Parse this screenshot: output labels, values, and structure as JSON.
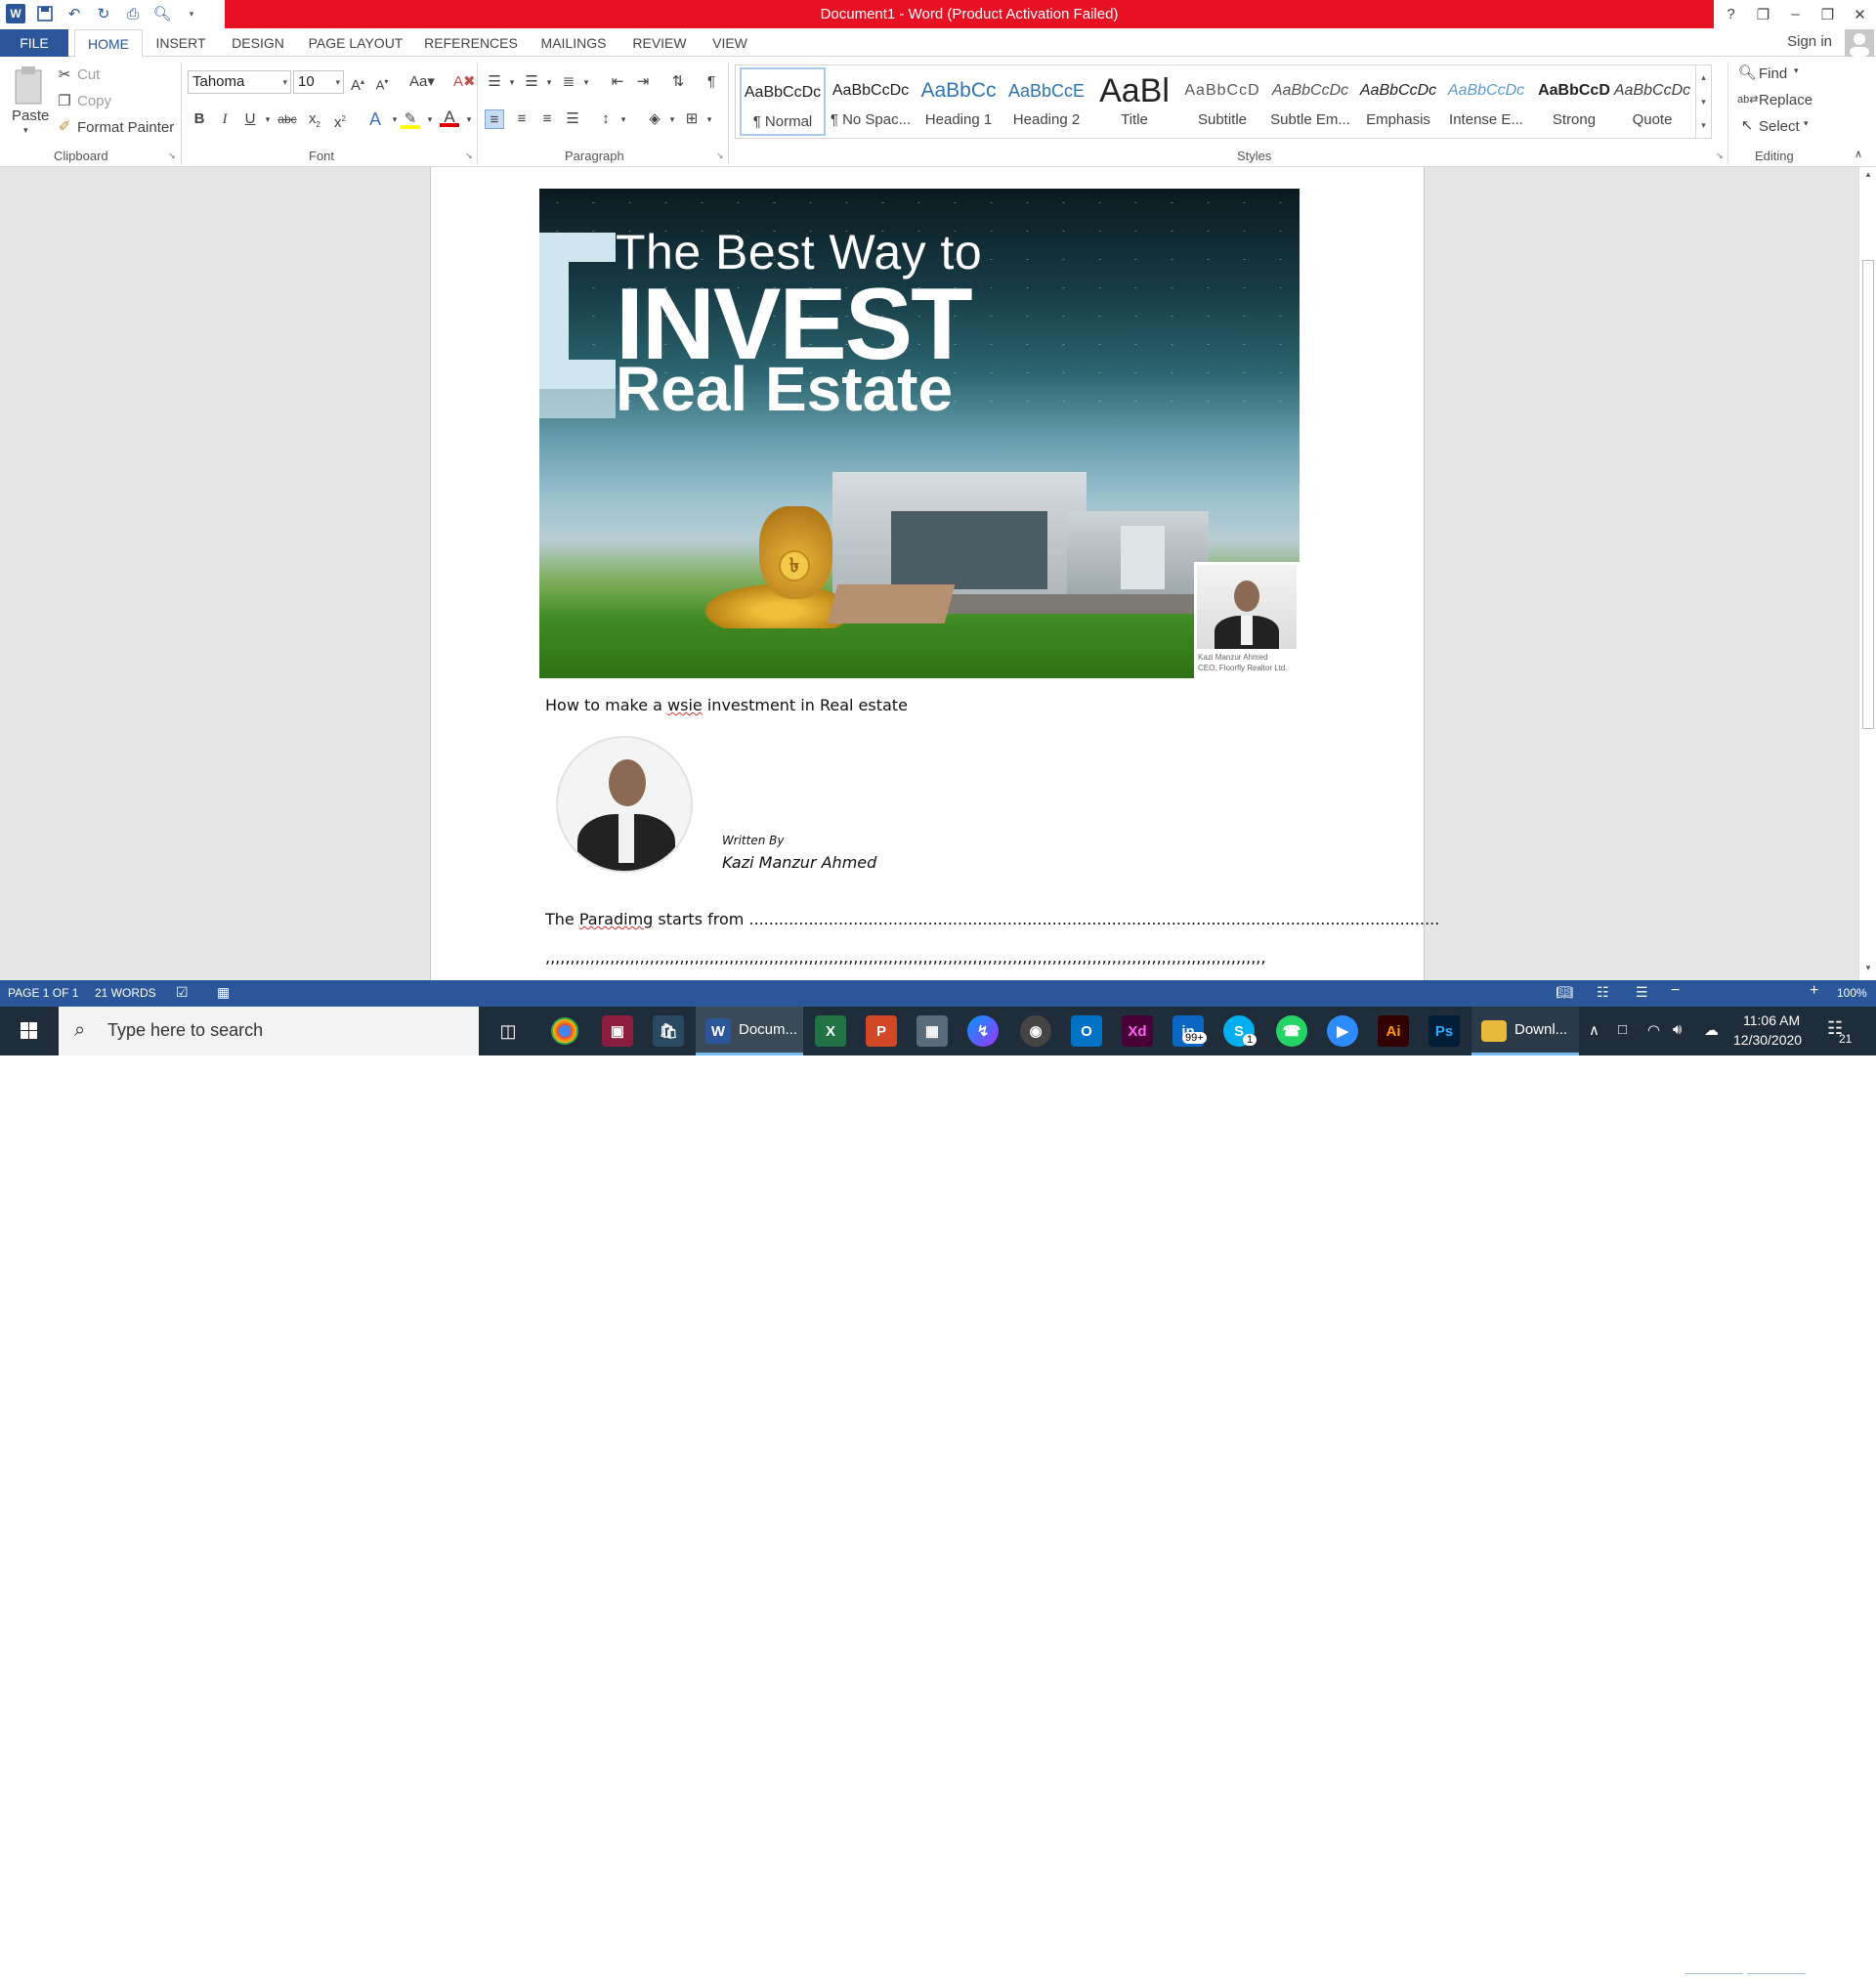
{
  "window": {
    "title": "Document1 -  Word (Product Activation Failed)",
    "controls": [
      "?",
      "❐",
      "–",
      "❒",
      "✕"
    ]
  },
  "ribbon_tabs": [
    "FILE",
    "HOME",
    "INSERT",
    "DESIGN",
    "PAGE LAYOUT",
    "REFERENCES",
    "MAILINGS",
    "REVIEW",
    "VIEW"
  ],
  "active_tab": "HOME",
  "sign_in": "Sign in",
  "clipboard": {
    "paste": "Paste",
    "cut": "Cut",
    "copy": "Copy",
    "format_painter": "Format Painter",
    "group": "Clipboard"
  },
  "font": {
    "name": "Tahoma",
    "size": "10",
    "group": "Font"
  },
  "paragraph": {
    "group": "Paragraph"
  },
  "styles": {
    "group": "Styles",
    "items": [
      {
        "sample": "AaBbCcDc",
        "name": "¶ Normal"
      },
      {
        "sample": "AaBbCcDc",
        "name": "¶ No Spac..."
      },
      {
        "sample": "AaBbCc",
        "name": "Heading 1"
      },
      {
        "sample": "AaBbCcE",
        "name": "Heading 2"
      },
      {
        "sample": "AaBl",
        "name": "Title"
      },
      {
        "sample": "AaBbCcD",
        "name": "Subtitle"
      },
      {
        "sample": "AaBbCcDc",
        "name": "Subtle Em..."
      },
      {
        "sample": "AaBbCcDc",
        "name": "Emphasis"
      },
      {
        "sample": "AaBbCcDc",
        "name": "Intense E..."
      },
      {
        "sample": "AaBbCcD",
        "name": "Strong"
      },
      {
        "sample": "AaBbCcDc",
        "name": "Quote"
      }
    ]
  },
  "editing": {
    "find": "Find",
    "replace": "Replace",
    "select": "Select",
    "group": "Editing"
  },
  "document": {
    "banner": {
      "line1": "The Best Way to",
      "line2": "INVEST",
      "line3": "Real Estate",
      "coin_symbol": "৳",
      "caption_name": "Kazi Manzur Ahmed",
      "caption_role": "CEO, Floorfly Realtor Ltd."
    },
    "heading_pre": "How to make a ",
    "heading_err": "wsie",
    "heading_post": " investment in Real estate",
    "written_by": "Written By",
    "author": "Kazi Manzur Ahmed",
    "para_pre": "The ",
    "para_err": "Paradimg",
    "para_post": " starts from ...........................................................................................................................................",
    "line2": ",,,,,,,,,,,,,,,,,,,,,,,,,,,,,,,,,,,,,,,,,,,,,,,,,,,,,,,,,,,,,,,,,,,,,,,,,,,,,,,,,,,,,,,,,,,,,,,,,,,,,,,,,,,,,,,,,,,,,,,,,,,,,,,,,,,,,,,,,,,,,,,,,"
  },
  "status": {
    "page": "PAGE 1 OF 1",
    "words": "21 WORDS",
    "zoom": "100%",
    "zoom_level": 1.0
  },
  "taskbar": {
    "search_placeholder": "Type here to search",
    "word_label": "Docum...",
    "downloads_label": "Downl...",
    "linkedin_badge": "99+",
    "skype_badge": "1",
    "time": "11:06 AM",
    "date": "12/30/2020",
    "notifications": "21"
  },
  "colors": {
    "accent": "#2b579a",
    "title_error": "#e81123",
    "taskbar": "#1f2d3a"
  }
}
